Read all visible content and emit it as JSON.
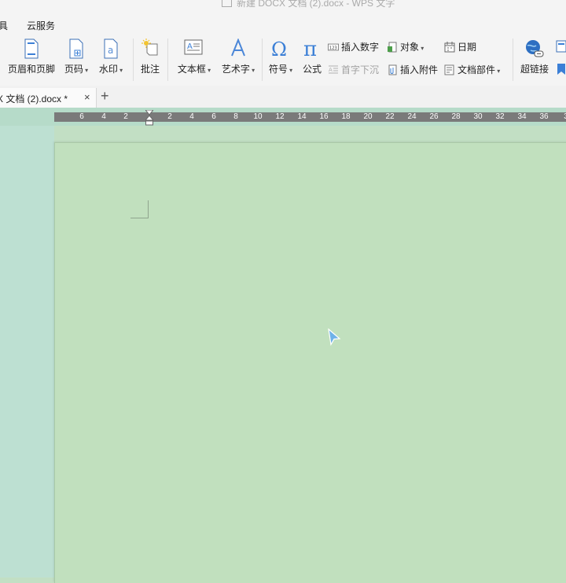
{
  "window": {
    "title": "新建 DOCX 文档 (2).docx  - WPS 文字"
  },
  "menu": {
    "items": [
      "具",
      "云服务"
    ]
  },
  "ribbon": {
    "header_footer": "页眉和页脚",
    "page_number": "页码",
    "watermark": "水印",
    "comment": "批注",
    "text_box": "文本框",
    "art_text": "艺术字",
    "symbol": "符号",
    "formula": "公式",
    "insert_number": "插入数字",
    "object": "对象",
    "date": "日期",
    "drop_cap": "首字下沉",
    "insert_attachment": "插入附件",
    "doc_parts": "文档部件",
    "hyperlink": "超链接",
    "insert_number_icon_text": "123"
  },
  "tabs": {
    "doc_tab_title": "X 文档 (2).docx *",
    "close": "×",
    "new": "+"
  },
  "ruler": {
    "ticks_left": [
      "6",
      "4",
      "2"
    ],
    "ticks_right": [
      "2",
      "4",
      "6",
      "8",
      "10",
      "12",
      "14",
      "16",
      "18",
      "20",
      "22",
      "24",
      "26",
      "28",
      "30",
      "32",
      "34",
      "36",
      "3"
    ]
  },
  "colors": {
    "page_background": "#c1e0be",
    "workspace_background": "#bde0d2",
    "ribbon_background": "#f4f4f4",
    "accent_blue": "#3b7fd6"
  },
  "icons": {
    "header_footer": "header-footer-icon",
    "page_number": "page-number-icon",
    "watermark": "watermark-icon",
    "comment": "comment-icon",
    "text_box": "text-box-icon",
    "art_text": "art-text-icon",
    "symbol": "omega-icon",
    "formula": "pi-icon",
    "hyperlink": "globe-link-icon"
  }
}
